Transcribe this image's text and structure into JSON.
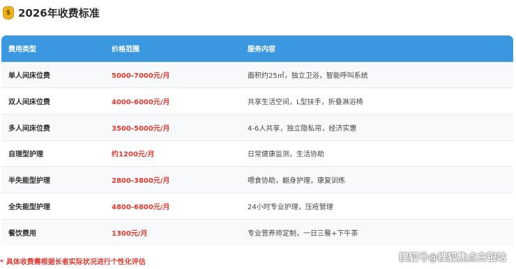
{
  "header": {
    "icon": "money-bag-icon",
    "icon_glyph": "$",
    "title": "2026年收费标准"
  },
  "table": {
    "columns": [
      "费用类型",
      "价格范围",
      "服务内容"
    ],
    "rows": [
      {
        "type": "单人间床位费",
        "price": "5000-7000元/月",
        "service": "面积约25㎡，独立卫浴，智能呼叫系统"
      },
      {
        "type": "双人间床位费",
        "price": "4000-6000元/月",
        "service": "共享生活空间，L型扶手，折叠淋浴椅"
      },
      {
        "type": "多人间床位费",
        "price": "3500-5000元/月",
        "service": "4-6人共享，独立隐私帘，经济实惠"
      },
      {
        "type": "自理型护理",
        "price": "约1200元/月",
        "service": "日常健康监测，生活协助"
      },
      {
        "type": "半失能型护理",
        "price": "2800-3800元/月",
        "service": "喂食协助，翻身护理，康复训练"
      },
      {
        "type": "全失能型护理",
        "price": "4800-6800元/月",
        "service": "24小时专业护理，压疮管理"
      },
      {
        "type": "餐饮费用",
        "price": "1300元/月",
        "service": "专业营养师定制，一日三餐+下午茶"
      }
    ]
  },
  "footnote": "* 具体收费需根据长者实际状况进行个性化评估",
  "watermark": "搜狐号@搜狐焦点白银站",
  "colors": {
    "header_bg": "#3a97e0",
    "price": "#e03a2f",
    "footnote": "#e03a2f"
  }
}
